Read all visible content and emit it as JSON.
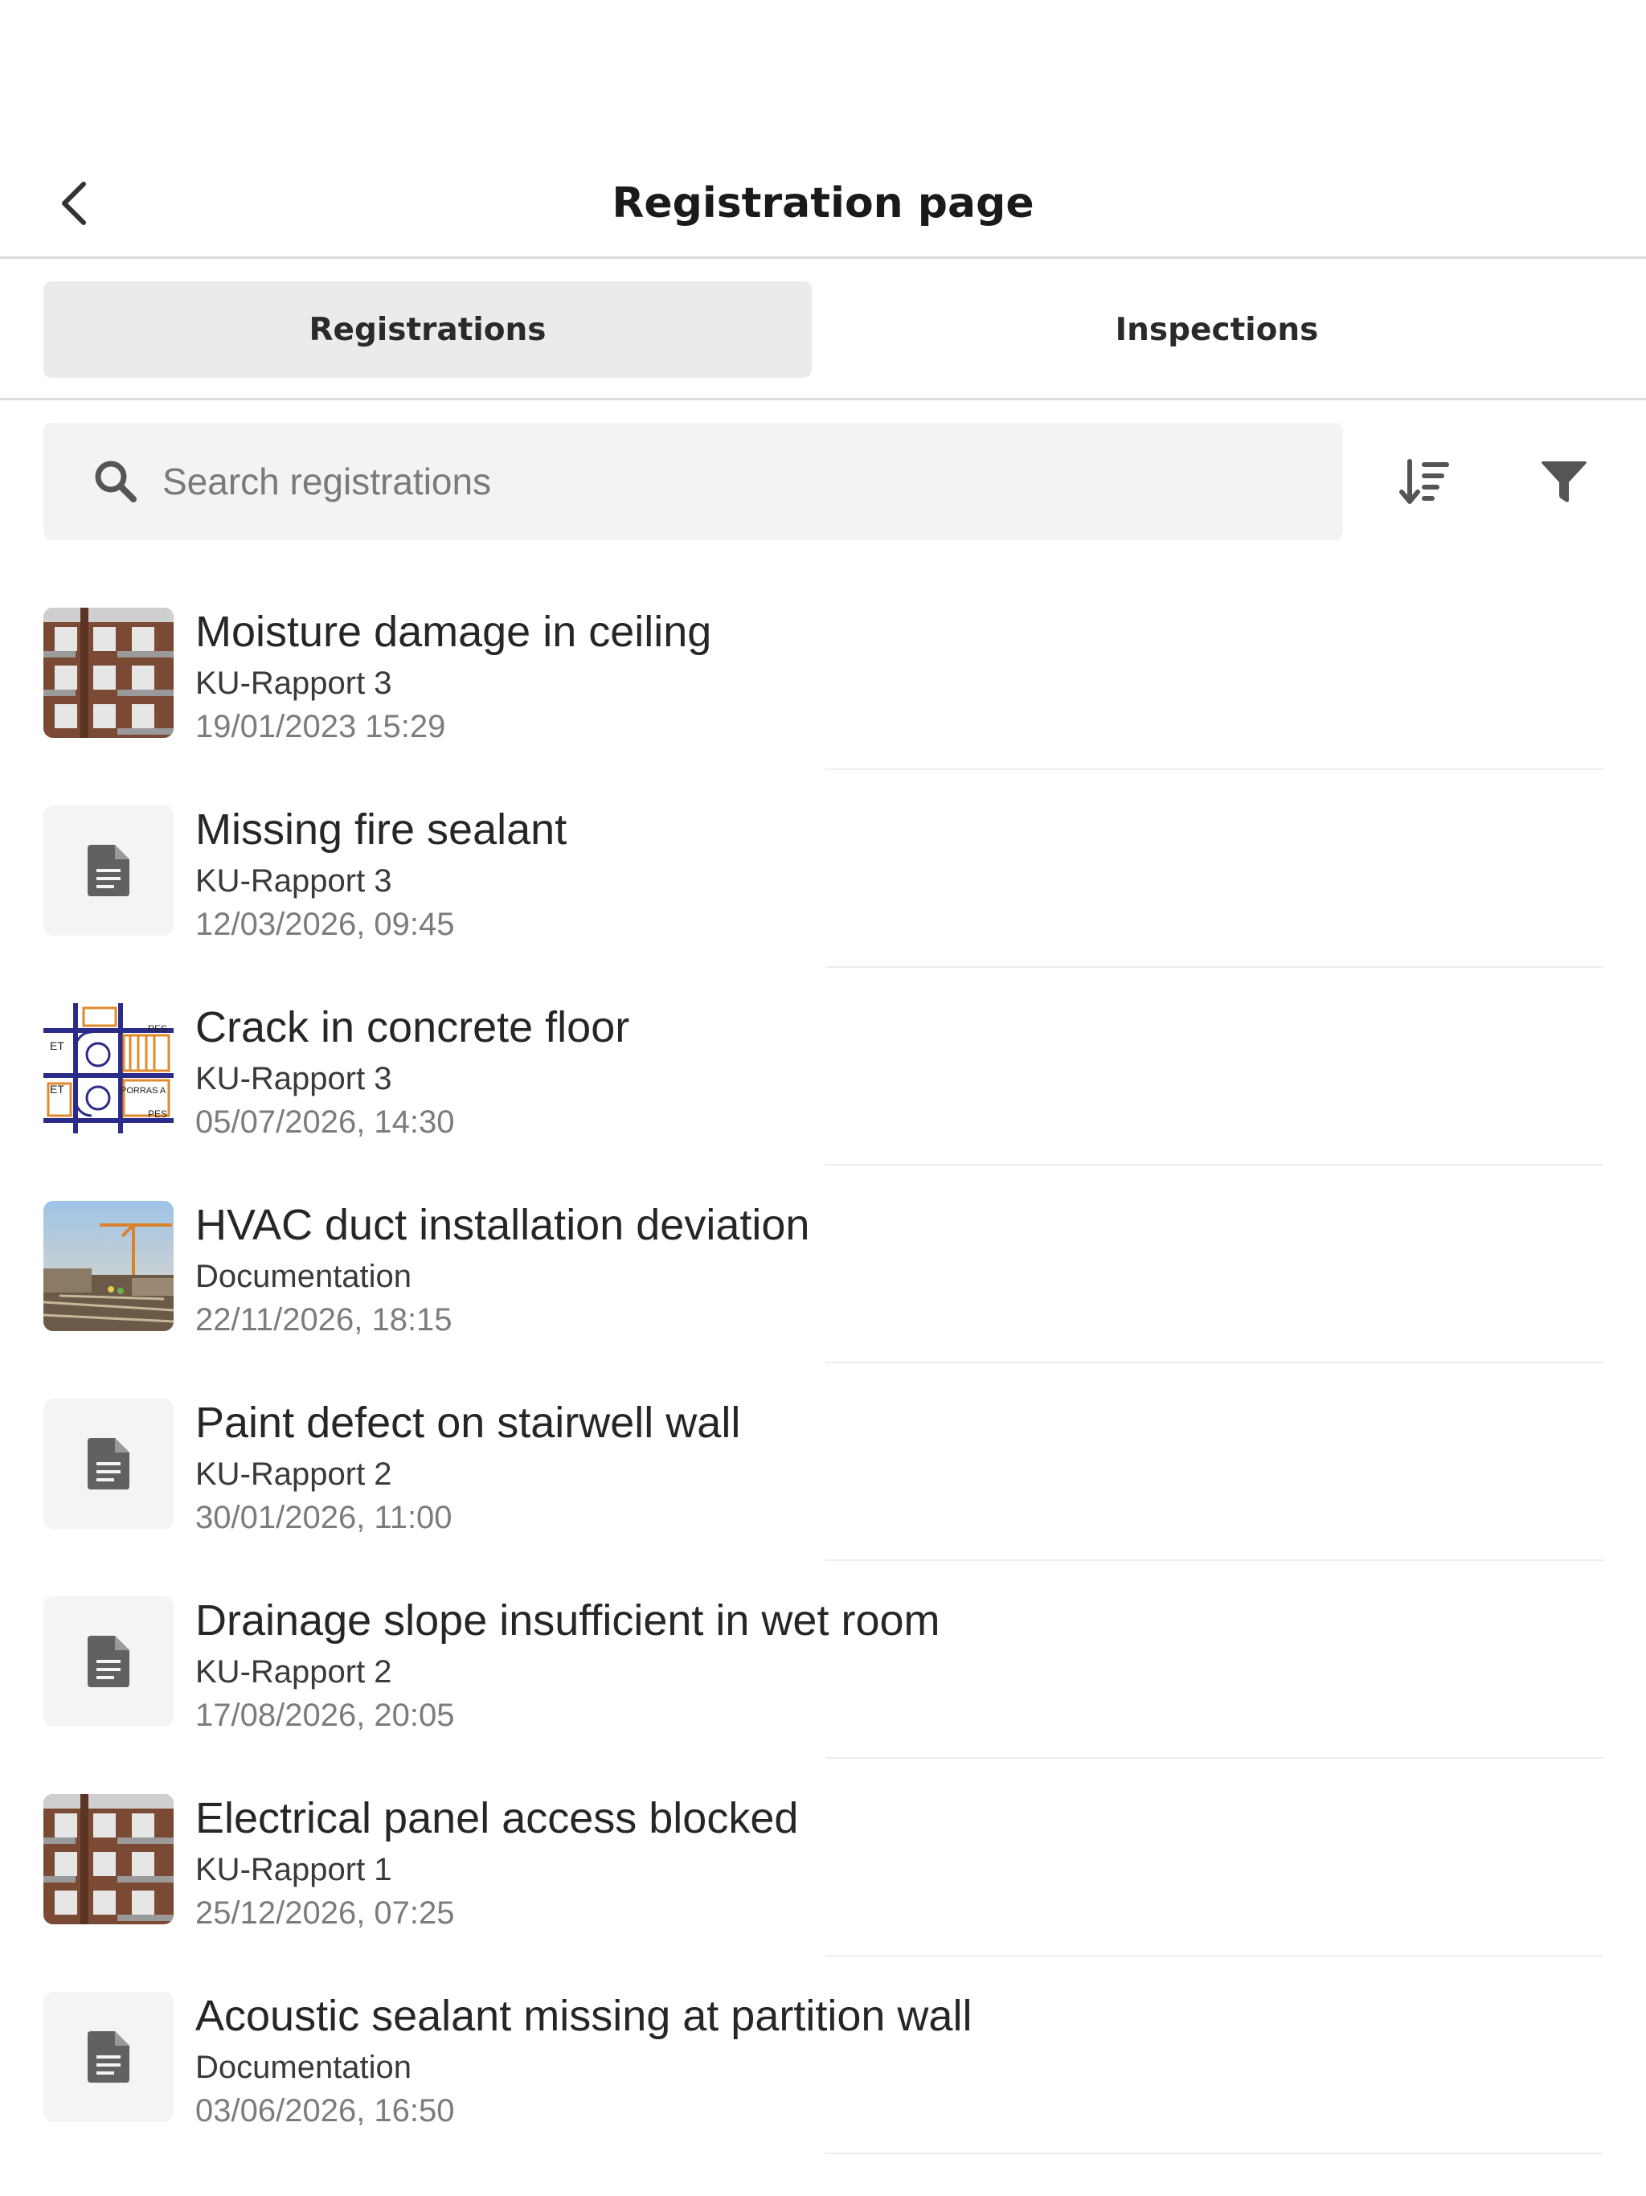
{
  "header": {
    "title": "Registration page",
    "back_icon": "chevron-left-icon"
  },
  "tabs": [
    {
      "label": "Registrations",
      "active": true
    },
    {
      "label": "Inspections",
      "active": false
    }
  ],
  "search": {
    "placeholder": "Search registrations",
    "value": "",
    "icon": "search-icon"
  },
  "toolbar": {
    "sort_icon": "sort-descending-icon",
    "filter_icon": "filter-icon"
  },
  "registrations": [
    {
      "title": "Moisture damage in ceiling",
      "source": "KU-Rapport 3",
      "date": "19/01/2023 15:29",
      "thumbnail": "building-facade-photo"
    },
    {
      "title": "Missing fire sealant",
      "source": "KU-Rapport 3",
      "date": "12/03/2026, 09:45",
      "thumbnail": "document-icon"
    },
    {
      "title": "Crack in concrete floor",
      "source": "KU-Rapport 3",
      "date": "05/07/2026, 14:30",
      "thumbnail": "floor-plan-image"
    },
    {
      "title": "HVAC duct installation deviation",
      "source": "Documentation",
      "date": "22/11/2026, 18:15",
      "thumbnail": "construction-site-photo"
    },
    {
      "title": "Paint defect on stairwell wall",
      "source": "KU-Rapport 2",
      "date": "30/01/2026, 11:00",
      "thumbnail": "document-icon"
    },
    {
      "title": "Drainage slope insufficient in wet room",
      "source": "KU-Rapport 2",
      "date": "17/08/2026, 20:05",
      "thumbnail": "document-icon"
    },
    {
      "title": "Electrical panel access blocked",
      "source": "KU-Rapport 1",
      "date": "25/12/2026, 07:25",
      "thumbnail": "building-facade-photo"
    },
    {
      "title": "Acoustic sealant missing at partition wall",
      "source": "Documentation",
      "date": "03/06/2026, 16:50",
      "thumbnail": "document-icon"
    }
  ],
  "colors": {
    "active_tab_bg": "#ebebeb",
    "search_bg": "#f3f3f3",
    "divider": "#dcdcdc",
    "icon": "#555555"
  }
}
